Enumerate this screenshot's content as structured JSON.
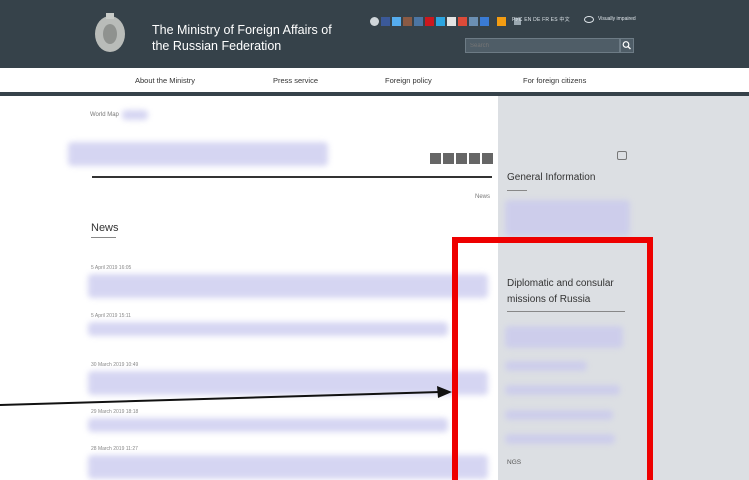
{
  "header": {
    "title": "The Ministry of Foreign Affairs of the Russian Federation",
    "languages": "РУС EN DE FR ES 中文",
    "visually_impaired": "Visually impaired",
    "search_placeholder": "Search"
  },
  "nav": {
    "items": [
      {
        "label": "About the Ministry"
      },
      {
        "label": "Press service"
      },
      {
        "label": "Foreign policy"
      },
      {
        "label": "For foreign citizens"
      }
    ]
  },
  "breadcrumb": "World Map",
  "main": {
    "news_link": "News",
    "news_heading": "News",
    "news_dates": [
      "5 April 2019 16:05",
      "5 April 2019 15:11",
      "30 March 2019 10:49",
      "29 March 2019 18:18",
      "28 March 2019 11:27"
    ]
  },
  "sidebar": {
    "general_info": "General Information",
    "diplomatic_missions": "Diplomatic and consular missions of Russia",
    "last_link": "NGS"
  },
  "colors": {
    "header_bg": "#36424a",
    "sidebar_bg": "#dcdfe3",
    "highlight": "#ee0000"
  }
}
